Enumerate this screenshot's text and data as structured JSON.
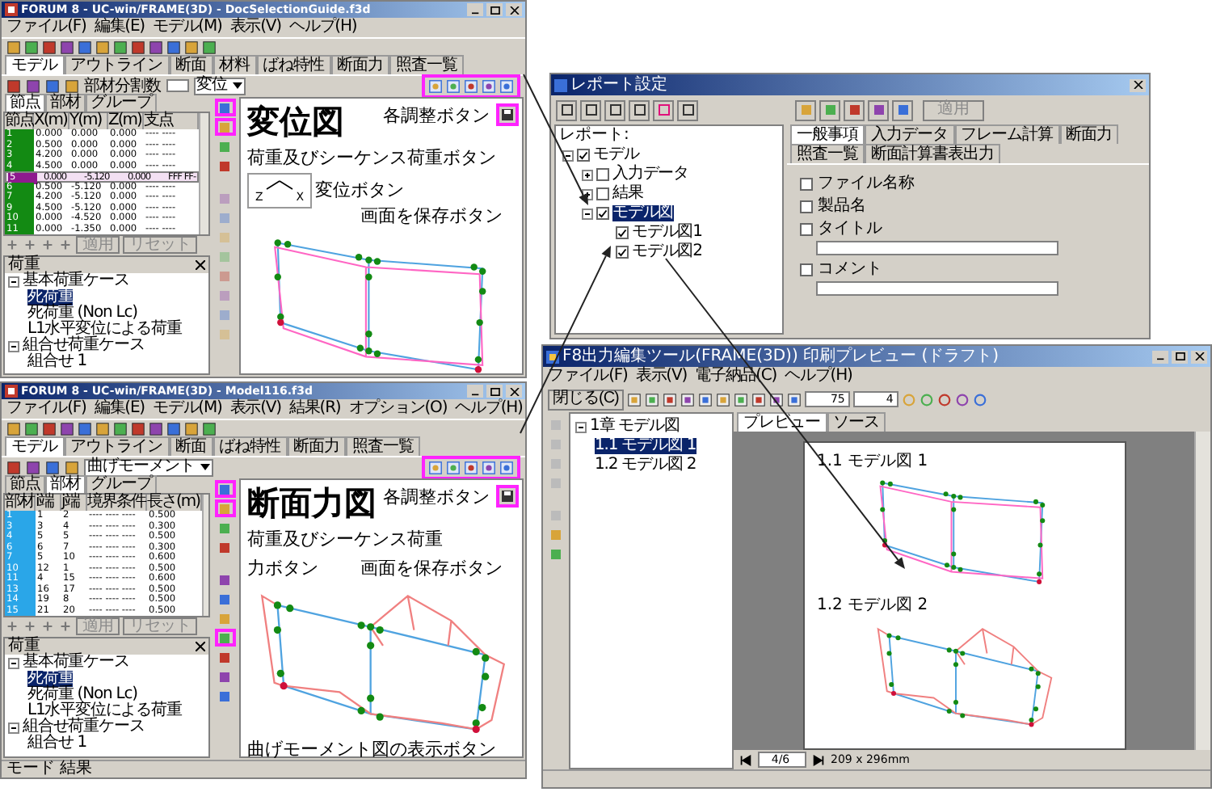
{
  "app_windows": [
    {
      "kind": "displacement",
      "title": "FORUM 8 - UC-win/FRAME(3D) - DocSelectionGuide.f3d",
      "menu": [
        "ファイル(F)",
        "編集(E)",
        "モデル(M)",
        "表示(V)",
        "ヘルプ(H)"
      ],
      "tabs": [
        {
          "label": "モデル",
          "selected": true
        },
        {
          "label": "アウトライン",
          "selected": false
        },
        {
          "label": "断面",
          "selected": false
        },
        {
          "label": "材料",
          "selected": false
        },
        {
          "label": "ばね特性",
          "selected": false
        },
        {
          "label": "断面力",
          "selected": false
        },
        {
          "label": "照査一覧",
          "selected": false
        }
      ],
      "division_label": "部材分割数",
      "view_select": "変位",
      "adjust_buttons": {
        "highlighted": true
      },
      "save_button": {
        "highlighted": true
      },
      "panel_tabs": [
        {
          "label": "節点",
          "selected": true
        },
        {
          "label": "部材",
          "selected": false
        },
        {
          "label": "グループ",
          "selected": false
        }
      ],
      "columns": [
        "節点",
        "X(m)",
        "Y(m)",
        "Z(m)",
        "支点"
      ],
      "rows": [
        {
          "cells": [
            "1",
            "0.000",
            "0.000",
            "0.000",
            "---- ----"
          ],
          "selected": false
        },
        {
          "cells": [
            "2",
            "0.500",
            "0.000",
            "0.000",
            "---- ----"
          ],
          "selected": false
        },
        {
          "cells": [
            "3",
            "4.200",
            "0.000",
            "0.000",
            "---- ----"
          ],
          "selected": false
        },
        {
          "cells": [
            "4",
            "4.500",
            "0.000",
            "0.000",
            "---- ----"
          ],
          "selected": false
        },
        {
          "cells": [
            "5",
            "0.000",
            "-5.120",
            "0.000",
            "FFF FF-"
          ],
          "selected": true
        },
        {
          "cells": [
            "6",
            "0.500",
            "-5.120",
            "0.000",
            "---- ----"
          ],
          "selected": false
        },
        {
          "cells": [
            "7",
            "4.200",
            "-5.120",
            "0.000",
            "---- ----"
          ],
          "selected": false
        },
        {
          "cells": [
            "9",
            "4.500",
            "-5.120",
            "0.000",
            "---- ----"
          ],
          "selected": false
        },
        {
          "cells": [
            "10",
            "0.000",
            "-4.520",
            "0.000",
            "---- ----"
          ],
          "selected": false
        },
        {
          "cells": [
            "11",
            "0.000",
            "-1.350",
            "0.000",
            "---- ----"
          ],
          "selected": false
        }
      ],
      "table_buttons": [
        {
          "label": "適用",
          "disabled": true
        },
        {
          "label": "リセット",
          "disabled": true
        }
      ],
      "load_tab": "荷重",
      "load_tree": [
        {
          "label": "基本荷重ケース",
          "expanded": true,
          "selected": false,
          "children": [
            {
              "label": "死荷重",
              "selected": true
            },
            {
              "label": "死荷重 (Non Lc)",
              "selected": false
            },
            {
              "label": "L1水平変位による荷重",
              "selected": false
            }
          ]
        },
        {
          "label": "組合せ荷重ケース",
          "expanded": true,
          "selected": false,
          "children": [
            {
              "label": "組合せ 1",
              "selected": false
            }
          ]
        }
      ],
      "axis_labels": [
        "Z",
        "X"
      ],
      "heading": "変位図",
      "callouts": [
        "各調整ボタン",
        "荷重及びシーケンス荷重ボタン",
        "変位ボタン",
        "画面を保存ボタン"
      ],
      "side_tools": [
        {
          "highlighted": true,
          "disabled": false
        },
        {
          "highlighted": true,
          "disabled": false
        },
        {
          "highlighted": false,
          "disabled": false
        },
        {
          "highlighted": false,
          "disabled": false
        },
        {
          "highlighted": false,
          "disabled": true
        },
        {
          "highlighted": false,
          "disabled": true
        },
        {
          "highlighted": false,
          "disabled": true
        },
        {
          "highlighted": false,
          "disabled": true
        },
        {
          "highlighted": false,
          "disabled": true
        },
        {
          "highlighted": false,
          "disabled": true
        },
        {
          "highlighted": false,
          "disabled": true
        },
        {
          "highlighted": false,
          "disabled": true
        }
      ]
    },
    {
      "kind": "section_force",
      "title": "FORUM 8 - UC-win/FRAME(3D) - Model116.f3d",
      "menu": [
        "ファイル(F)",
        "編集(E)",
        "モデル(M)",
        "表示(V)",
        "結果(R)",
        "オプション(O)",
        "ヘルプ(H)"
      ],
      "tabs": [
        {
          "label": "モデル",
          "selected": true
        },
        {
          "label": "アウトライン",
          "selected": false
        },
        {
          "label": "断面",
          "selected": false
        },
        {
          "label": "ばね特性",
          "selected": false
        },
        {
          "label": "断面力",
          "selected": false
        },
        {
          "label": "照査一覧",
          "selected": false
        }
      ],
      "view_select": "曲げモーメント",
      "adjust_buttons": {
        "highlighted": true
      },
      "save_button": {
        "highlighted": true
      },
      "panel_tabs": [
        {
          "label": "節点",
          "selected": false
        },
        {
          "label": "部材",
          "selected": true
        },
        {
          "label": "グループ",
          "selected": false
        }
      ],
      "columns": [
        "部材",
        "i端",
        "j端",
        "境界条件",
        "長さ(m)"
      ],
      "rows": [
        {
          "cells": [
            "1",
            "1",
            "2",
            "---- ---- ----",
            "0.500"
          ],
          "selected": false
        },
        {
          "cells": [
            "3",
            "3",
            "4",
            "---- ---- ----",
            "0.300"
          ],
          "selected": false
        },
        {
          "cells": [
            "4",
            "5",
            "5",
            "---- ---- ----",
            "0.500"
          ],
          "selected": false
        },
        {
          "cells": [
            "6",
            "6",
            "7",
            "---- ---- ----",
            "0.300"
          ],
          "selected": false
        },
        {
          "cells": [
            "7",
            "5",
            "10",
            "---- ---- ----",
            "0.600"
          ],
          "selected": false
        },
        {
          "cells": [
            "10",
            "12",
            "1",
            "---- ---- ----",
            "0.500"
          ],
          "selected": false
        },
        {
          "cells": [
            "11",
            "4",
            "15",
            "---- ---- ----",
            "0.600"
          ],
          "selected": false
        },
        {
          "cells": [
            "13",
            "16",
            "17",
            "---- ---- ----",
            "0.500"
          ],
          "selected": false
        },
        {
          "cells": [
            "14",
            "19",
            "8",
            "---- ---- ----",
            "0.500"
          ],
          "selected": false
        },
        {
          "cells": [
            "15",
            "21",
            "20",
            "---- ---- ----",
            "0.500"
          ],
          "selected": false
        }
      ],
      "table_buttons": [
        {
          "label": "適用",
          "disabled": true
        },
        {
          "label": "リセット",
          "disabled": true
        }
      ],
      "load_tab": "荷重",
      "load_tree": [
        {
          "label": "基本荷重ケース",
          "expanded": true,
          "selected": false,
          "children": [
            {
              "label": "死荷重",
              "selected": true
            },
            {
              "label": "死荷重 (Non Lc)",
              "selected": false
            },
            {
              "label": "L1水平変位による荷重",
              "selected": false
            }
          ]
        },
        {
          "label": "組合せ荷重ケース",
          "expanded": true,
          "selected": false,
          "children": [
            {
              "label": "組合せ 1",
              "selected": false
            }
          ]
        }
      ],
      "heading": "断面力図",
      "callouts": [
        "各調整ボタン",
        "荷重及びシーケンス荷重",
        "力ボタン",
        "画面を保存ボタン",
        "曲げモーメント図の表示ボタン"
      ],
      "side_tools": [
        {
          "highlighted": true,
          "disabled": false
        },
        {
          "highlighted": true,
          "disabled": false
        },
        {
          "highlighted": false,
          "disabled": false
        },
        {
          "highlighted": false,
          "disabled": false
        },
        {
          "highlighted": false,
          "disabled": false
        },
        {
          "highlighted": false,
          "disabled": false
        },
        {
          "highlighted": false,
          "disabled": false
        },
        {
          "highlighted": true,
          "disabled": false
        },
        {
          "highlighted": false,
          "disabled": false
        },
        {
          "highlighted": false,
          "disabled": false
        },
        {
          "highlighted": false,
          "disabled": false
        }
      ],
      "status": "モード 結果"
    }
  ],
  "report_dialog": {
    "title": "レポート設定",
    "tree_label": "レポート:",
    "tree": [
      {
        "label": "モデル",
        "expanded": true,
        "checked": true,
        "selected": false,
        "children": [
          {
            "label": "入力データ",
            "expanded": false,
            "checked": false,
            "selected": false
          },
          {
            "label": "結果",
            "expanded": false,
            "checked": false,
            "selected": false
          },
          {
            "label": "モデル図",
            "expanded": true,
            "checked": true,
            "selected": true,
            "children": [
              {
                "label": "モデル図1",
                "checked": true,
                "selected": false
              },
              {
                "label": "モデル図2",
                "checked": true,
                "selected": false
              }
            ]
          }
        ]
      }
    ],
    "tabs": [
      {
        "label": "一般事項",
        "selected": true
      },
      {
        "label": "入力データ",
        "selected": false
      },
      {
        "label": "フレーム計算",
        "selected": false
      },
      {
        "label": "断面力",
        "selected": false
      },
      {
        "label": "照査一覧",
        "selected": false
      },
      {
        "label": "断面計算書表出力",
        "selected": false
      }
    ],
    "options": [
      {
        "label": "ファイル名称",
        "checked": false,
        "kind": "check"
      },
      {
        "label": "製品名",
        "checked": false,
        "kind": "check"
      },
      {
        "label": "タイトル",
        "checked": false,
        "kind": "check_field"
      },
      {
        "label": "コメント",
        "checked": false,
        "kind": "check_field"
      }
    ],
    "apply": {
      "label": "適用",
      "disabled": true
    }
  },
  "preview_window": {
    "title": "F8出力編集ツール(FRAME(3D)) 印刷プレビュー (ドラフト)",
    "menu": [
      "ファイル(F)",
      "表示(V)",
      "電子納品(C)",
      "ヘルプ(H)"
    ],
    "close_button": "閉じる(C)",
    "zoom": "75",
    "page": "4",
    "tree": [
      {
        "label": "1章 モデル図",
        "expanded": true,
        "selected": false,
        "children": [
          {
            "label": "1.1 モデル図 1",
            "selected": true
          },
          {
            "label": "1.2 モデル図 2",
            "selected": false
          }
        ]
      }
    ],
    "tabs": [
      {
        "label": "プレビュー",
        "selected": true
      },
      {
        "label": "ソース",
        "selected": false
      }
    ],
    "sections": [
      {
        "heading": "1.1 モデル図 1",
        "kind": "displacement"
      },
      {
        "heading": "1.2 モデル図 2",
        "kind": "section_force"
      }
    ],
    "page_counter": "4/6",
    "paper_size": "209 x 296mm"
  }
}
